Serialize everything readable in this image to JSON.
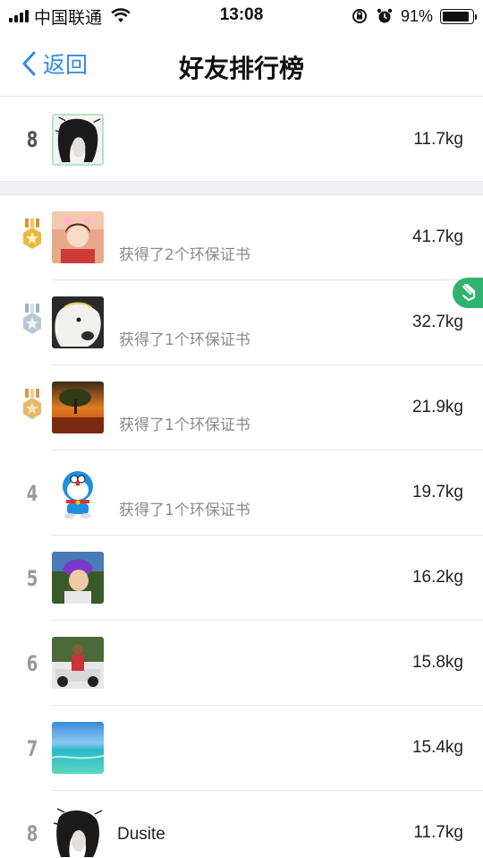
{
  "status_bar": {
    "carrier": "中国联通",
    "time": "13:08",
    "battery_percent": "91%",
    "battery_level": 0.91
  },
  "nav": {
    "back_label": "返回",
    "title": "好友排行榜"
  },
  "my_rank": {
    "rank": "8",
    "weight": "11.7kg"
  },
  "rows": [
    {
      "rank": "1",
      "medal": "gold",
      "subtitle": "获得了2个环保证书",
      "weight": "41.7kg"
    },
    {
      "rank": "2",
      "medal": "silver",
      "subtitle": "获得了1个环保证书",
      "weight": "32.7kg"
    },
    {
      "rank": "3",
      "medal": "bronze",
      "subtitle": "获得了1个环保证书",
      "weight": "21.9kg"
    },
    {
      "rank": "4",
      "subtitle": "获得了1个环保证书",
      "weight": "19.7kg"
    },
    {
      "rank": "5",
      "weight": "16.2kg"
    },
    {
      "rank": "6",
      "weight": "15.8kg"
    },
    {
      "rank": "7",
      "weight": "15.4kg"
    },
    {
      "rank": "8",
      "name": "Dusite",
      "weight": "11.7kg"
    }
  ],
  "colors": {
    "accent": "#2f8ce8",
    "gold": "#f0b63c",
    "silver": "#b7c8da",
    "bronze": "#e8b86a",
    "float_tab": "#2fb36e"
  }
}
